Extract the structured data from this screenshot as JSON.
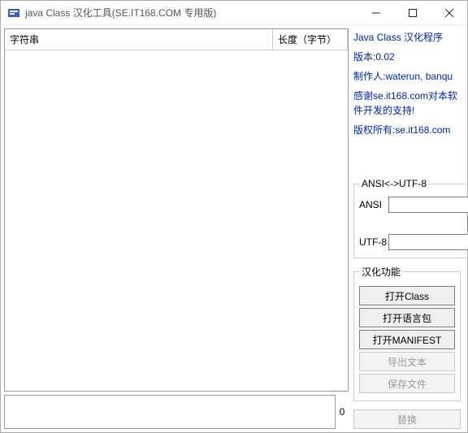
{
  "window": {
    "title": "java Class 汉化工具(SE.IT168.COM 专用版)"
  },
  "table": {
    "col1": "字符串",
    "col2": "长度（字节）",
    "rows": []
  },
  "info": {
    "title": "Java Class 汉化程序",
    "version": "版本:0.02",
    "author": "制作人:waterun, banqu",
    "thanks": "感谢se.it168.com对本软件开发的支持!",
    "copyright": "版权所有:se.it168.com"
  },
  "ansi": {
    "legend": "ANSI<->UTF-8",
    "label_ansi": "ANSI",
    "label_utf8": "UTF-8",
    "value_ansi": "",
    "value_utf8": "",
    "down": "↓",
    "up": "↑"
  },
  "func": {
    "legend": "汉化功能",
    "open_class": "打开Class",
    "open_lang": "打开语言包",
    "open_manifest": "打开MANIFEST",
    "export_text": "导出文本",
    "save_file": "保存文件"
  },
  "replace": {
    "label": "替换",
    "count": "0"
  },
  "editor": {
    "value": ""
  }
}
